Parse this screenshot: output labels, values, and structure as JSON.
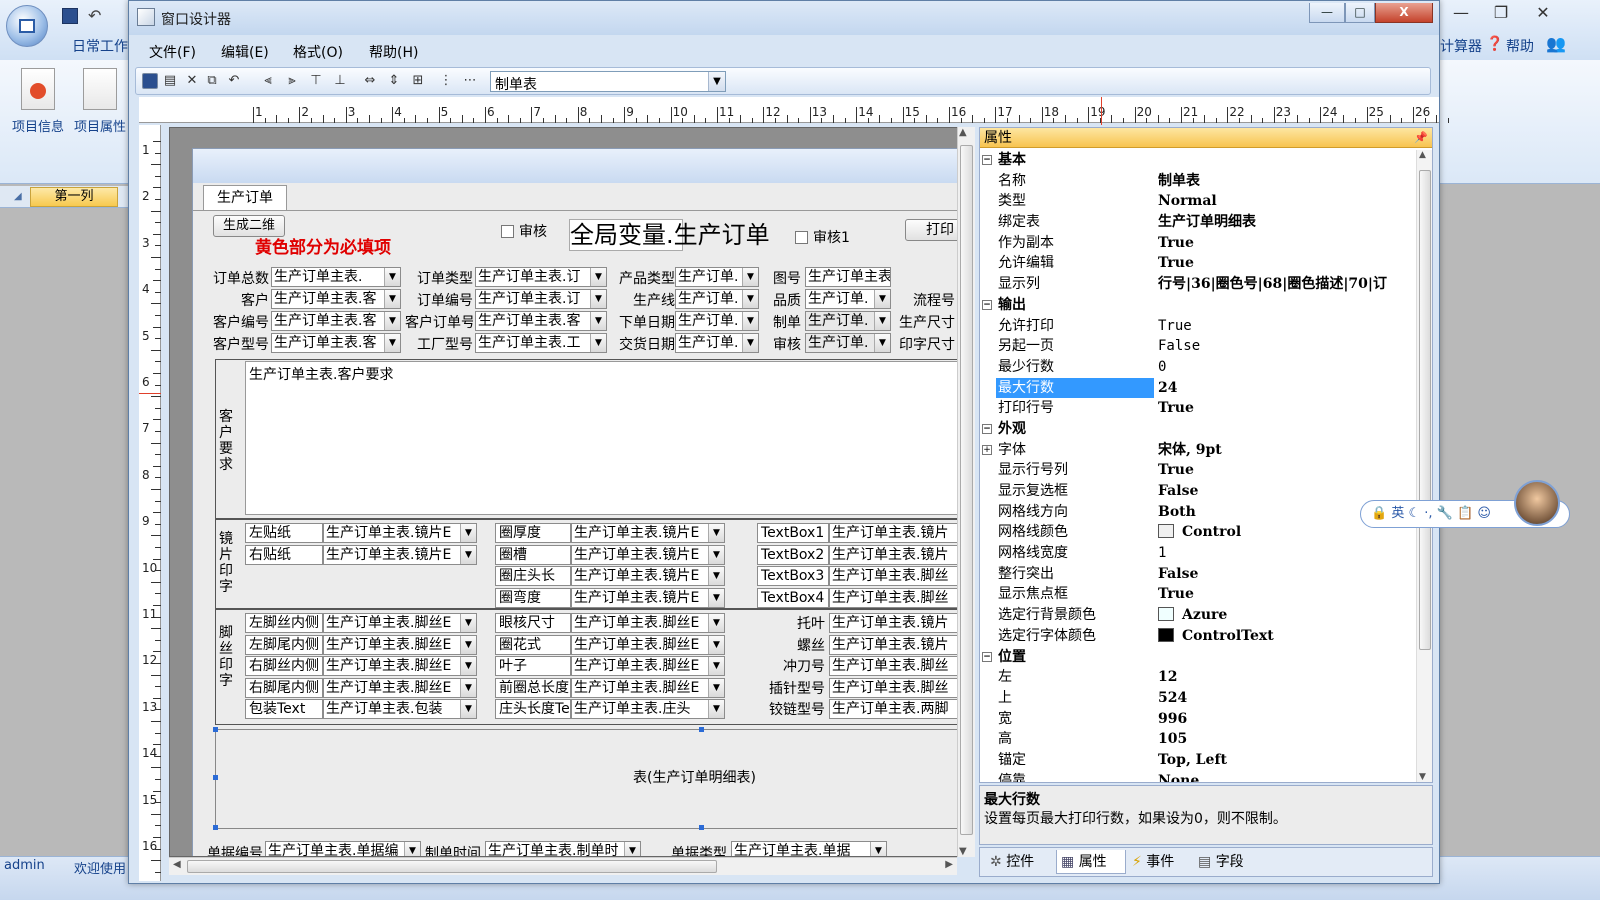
{
  "background_app": {
    "ribbon_tab": "日常工作",
    "ribbon_buttons": [
      {
        "label": "项目信息"
      },
      {
        "label": "项目属性"
      }
    ],
    "right_items": [
      "计算器",
      "帮助"
    ],
    "column_label": "第一列",
    "status_user": "admin",
    "status_welcome": "欢迎使用"
  },
  "window": {
    "title": "窗口设计器",
    "min_label": "—",
    "max_label": "□",
    "close_label": "X"
  },
  "menu": [
    {
      "label": "文件(F)"
    },
    {
      "label": "编辑(E)"
    },
    {
      "label": "格式(O)"
    },
    {
      "label": "帮助(H)"
    }
  ],
  "toolbar": {
    "combo_value": "制单表"
  },
  "ruler": {
    "h": [
      "1",
      "2",
      "3",
      "4",
      "5",
      "6",
      "7",
      "8",
      "9",
      "10",
      "11",
      "12",
      "13",
      "14",
      "15",
      "16",
      "17",
      "18",
      "19",
      "20",
      "21",
      "22",
      "23",
      "24",
      "25",
      "26"
    ],
    "v": [
      "1",
      "2",
      "3",
      "4",
      "5",
      "6",
      "7",
      "8",
      "9",
      "10",
      "11",
      "12",
      "13",
      "14",
      "15",
      "16"
    ]
  },
  "form": {
    "tab": "生产订单",
    "gen_button": "生成二维",
    "required_note": "黄色部分为必填项",
    "check_audit": "审核",
    "global_title": "全局变量.生产订单",
    "check_audit1": "审核1",
    "print_button": "打印",
    "rows": [
      [
        {
          "l": "订单总数",
          "v": "生产订单主表."
        },
        {
          "l": "订单类型",
          "v": "生产订单主表.订"
        },
        {
          "l": "产品类型",
          "v": "生产订单."
        },
        {
          "l": "图号",
          "v": "生产订单主表.图号"
        }
      ],
      [
        {
          "l": "客户",
          "v": "生产订单主表.客"
        },
        {
          "l": "订单编号",
          "v": "生产订单主表.订"
        },
        {
          "l": "生产线",
          "v": "生产订单."
        },
        {
          "l": "品质",
          "v": "生产订单."
        },
        {
          "l": "流程号",
          "v": ""
        }
      ],
      [
        {
          "l": "客户编号",
          "v": "生产订单主表.客"
        },
        {
          "l": "客户订单号",
          "v": "生产订单主表.客"
        },
        {
          "l": "下单日期",
          "v": "生产订单."
        },
        {
          "l": "制单",
          "v": "生产订单."
        },
        {
          "l": "生产尺寸",
          "v": ""
        }
      ],
      [
        {
          "l": "客户型号",
          "v": "生产订单主表.客"
        },
        {
          "l": "工厂型号",
          "v": "生产订单主表.工"
        },
        {
          "l": "交货日期",
          "v": "生产订单."
        },
        {
          "l": "审核",
          "v": "生产订单."
        },
        {
          "l": "印字尺寸",
          "v": ""
        }
      ]
    ],
    "req_group_label": "客户要求",
    "req_value": "生产订单主表.客户要求",
    "lens_group_label": "镜片印字",
    "lens_rows": [
      {
        "a": "左贴纸",
        "av": "生产订单主表.镜片E",
        "b": "圈厚度",
        "bv": "生产订单主表.镜片E",
        "c": "TextBox1",
        "cv": "生产订单主表.镜片"
      },
      {
        "a": "右贴纸",
        "av": "生产订单主表.镜片E",
        "b": "圈槽",
        "bv": "生产订单主表.镜片E",
        "c": "TextBox2",
        "cv": "生产订单主表.镜片"
      },
      {
        "a": "",
        "av": "",
        "b": "圈庄头长",
        "bv": "生产订单主表.镜片E",
        "c": "TextBox3",
        "cv": "生产订单主表.脚丝"
      },
      {
        "a": "",
        "av": "",
        "b": "圈弯度",
        "bv": "生产订单主表.镜片E",
        "c": "TextBox4",
        "cv": "生产订单主表.脚丝"
      }
    ],
    "leg_group_label": "脚丝印字",
    "leg_rows": [
      {
        "a": "左脚丝内侧",
        "av": "生产订单主表.脚丝E",
        "b": "眼核尺寸",
        "bv": "生产订单主表.脚丝E",
        "c": "托叶",
        "cv": "生产订单主表.镜片"
      },
      {
        "a": "左脚尾内侧",
        "av": "生产订单主表.脚丝E",
        "b": "圈花式",
        "bv": "生产订单主表.脚丝E",
        "c": "螺丝",
        "cv": "生产订单主表.镜片"
      },
      {
        "a": "右脚丝内侧",
        "av": "生产订单主表.脚丝E",
        "b": "叶子",
        "bv": "生产订单主表.脚丝E",
        "c": "冲刀号",
        "cv": "生产订单主表.脚丝"
      },
      {
        "a": "右脚尾内侧",
        "av": "生产订单主表.脚丝E",
        "b": "前圈总长度",
        "bv": "生产订单主表.脚丝E",
        "c": "插针型号",
        "cv": "生产订单主表.脚丝"
      },
      {
        "a": "包装Text",
        "av": "生产订单主表.包装",
        "b": "庄头长度Te",
        "bv": "生产订单主表.庄头",
        "c": "铰链型号",
        "cv": "生产订单主表.两脚"
      }
    ],
    "detail_table": "表(生产订单明细表)",
    "bottom_row": [
      {
        "l": "单据编号",
        "v": "生产订单主表.单据编"
      },
      {
        "l": "制单时间",
        "v": "生产订单主表.制单时"
      },
      {
        "l": "单据类型",
        "v": "生产订单主表.单据"
      }
    ]
  },
  "properties": {
    "title": "属性",
    "rows": [
      {
        "cat": true,
        "k": "基本"
      },
      {
        "k": "名称",
        "v": "制单表"
      },
      {
        "k": "类型",
        "v": "Normal"
      },
      {
        "k": "绑定表",
        "v": "生产订单明细表"
      },
      {
        "k": "作为副本",
        "v": "True"
      },
      {
        "k": "允许编辑",
        "v": "True"
      },
      {
        "k": "显示列",
        "v": "行号|36|圈色号|68|圈色描述|70|订"
      },
      {
        "cat": true,
        "k": "输出"
      },
      {
        "k": "允许打印",
        "v": "True",
        "m": true
      },
      {
        "k": "另起一页",
        "v": "False",
        "m": true
      },
      {
        "k": "最少行数",
        "v": "0",
        "m": true
      },
      {
        "k": "最大行数",
        "v": "24",
        "sel": true
      },
      {
        "k": "打印行号",
        "v": "True"
      },
      {
        "cat": true,
        "k": "外观"
      },
      {
        "k": "字体",
        "v": "宋体, 9pt",
        "expand": true
      },
      {
        "k": "显示行号列",
        "v": "True"
      },
      {
        "k": "显示复选框",
        "v": "False"
      },
      {
        "k": "网格线方向",
        "v": "Both"
      },
      {
        "k": "网格线颜色",
        "v": "Control",
        "swatch": "#f0f0f0"
      },
      {
        "k": "网格线宽度",
        "v": "1",
        "m": true
      },
      {
        "k": "整行突出",
        "v": "False"
      },
      {
        "k": "显示焦点框",
        "v": "True"
      },
      {
        "k": "选定行背景颜色",
        "v": "Azure",
        "swatch": "#f0ffff"
      },
      {
        "k": "选定行字体颜色",
        "v": "ControlText",
        "swatch": "#000000"
      },
      {
        "cat": true,
        "k": "位置"
      },
      {
        "k": "左",
        "v": "12"
      },
      {
        "k": "上",
        "v": "524"
      },
      {
        "k": "宽",
        "v": "996"
      },
      {
        "k": "高",
        "v": "105"
      },
      {
        "k": "锚定",
        "v": "Top, Left"
      },
      {
        "k": "停靠",
        "v": "None"
      }
    ],
    "desc_title": "最大行数",
    "desc_text": "设置每页最大打印行数，如果设为0，则不限制。",
    "tabs": [
      {
        "label": "控件"
      },
      {
        "label": "属性"
      },
      {
        "label": "事件"
      },
      {
        "label": "字段"
      }
    ]
  },
  "ime": {
    "text": "英"
  },
  "colors": {
    "accent": "#f8c450",
    "selection": "#3399ff",
    "required_note": "#e00000"
  }
}
